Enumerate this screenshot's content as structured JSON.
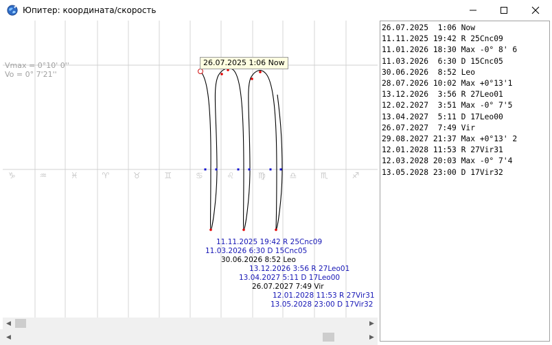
{
  "window": {
    "title": "Юпитер: координата/скорость",
    "minimize_glyph": "—",
    "maximize_glyph": "☐",
    "close_glyph": "✕"
  },
  "plot": {
    "vmax_label": "Vmax = 0°10' 0''",
    "vo_label": "Vo = 0° 7'21''",
    "tooltip": "26.07.2025  1:06 Now",
    "zodiac_glyphs": [
      "♑",
      "♒",
      "♓",
      "♈",
      "♉",
      "♊",
      "♋",
      "♌",
      "♍",
      "♎",
      "♏",
      "♐"
    ],
    "events": [
      {
        "text": "11.11.2025 19:42 R  25Cnc09",
        "color": "blue"
      },
      {
        "text": "11.03.2026  6:30 D  15Cnc05",
        "color": "blue"
      },
      {
        "text": "30.06.2026  8:52 Leo",
        "color": "black"
      },
      {
        "text": "13.12.2026  3:56 R  27Leo01",
        "color": "blue"
      },
      {
        "text": "13.04.2027  5:11 D  17Leo00",
        "color": "blue"
      },
      {
        "text": "26.07.2027  7:49 Vir",
        "color": "black"
      },
      {
        "text": "12.01.2028 11:53 R  27Vir31",
        "color": "blue"
      },
      {
        "text": "13.05.2028 23:00 D  17Vir32",
        "color": "blue"
      }
    ]
  },
  "list": {
    "rows": [
      "26.07.2025  1:06 Now",
      "11.11.2025 19:42 R 25Cnc09",
      "11.01.2026 18:30 Max -0° 8' 6",
      "11.03.2026  6:30 D 15Cnc05",
      "30.06.2026  8:52 Leo",
      "28.07.2026 10:02 Max +0°13'1",
      "13.12.2026  3:56 R 27Leo01",
      "12.02.2027  3:51 Max -0° 7'5",
      "13.04.2027  5:11 D 17Leo00",
      "26.07.2027  7:49 Vir",
      "29.08.2027 21:37 Max +0°13' 2",
      "12.01.2028 11:53 R 27Vir31",
      "12.03.2028 20:03 Max -0° 7'4",
      "13.05.2028 23:00 D 17Vir32"
    ]
  },
  "scroll": {
    "left_arrow": "◀",
    "right_arrow": "▶"
  }
}
